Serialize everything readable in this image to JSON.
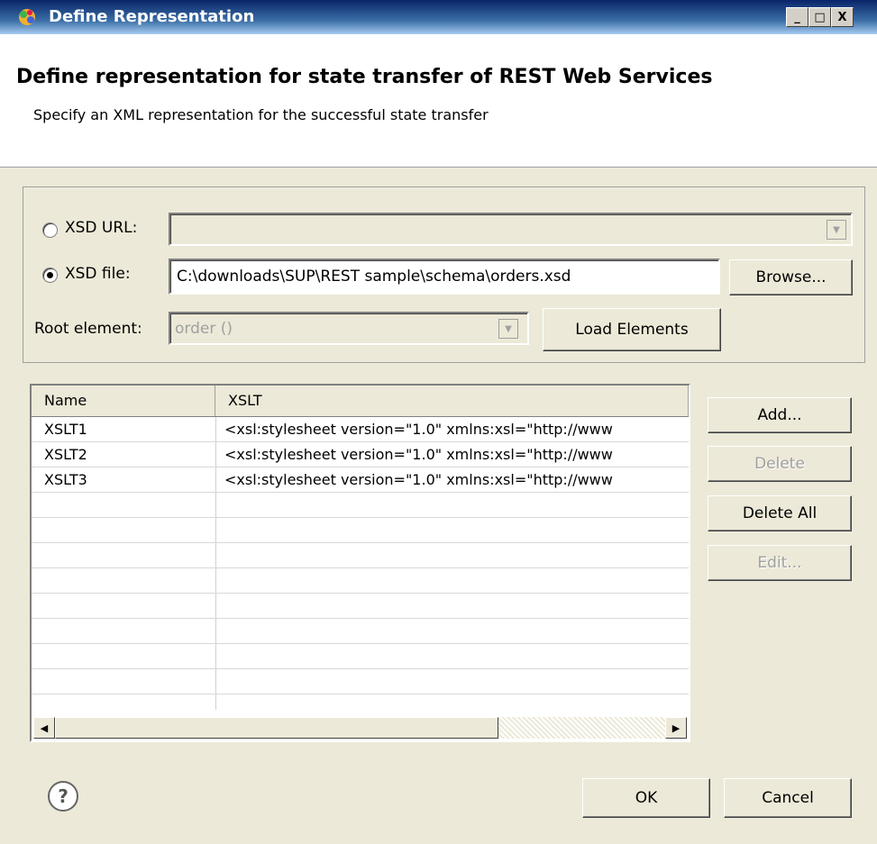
{
  "window": {
    "title": "Define Representation",
    "app_icon": "colorful-globe-icon",
    "minimize_glyph": "_",
    "maximize_glyph": "□",
    "close_glyph": "X"
  },
  "header": {
    "title": "Define representation for state transfer of REST Web Services",
    "description": "Specify an XML representation for the successful state transfer"
  },
  "form": {
    "xsd_url": {
      "label": "XSD URL:",
      "value": "",
      "selected": false
    },
    "xsd_file": {
      "label": "XSD file:",
      "value": "C:\\downloads\\SUP\\REST sample\\schema\\orders.xsd",
      "selected": true
    },
    "browse_label": "Browse...",
    "root_element": {
      "label": "Root element:",
      "value": "order ()"
    },
    "load_elements_label": "Load Elements"
  },
  "table": {
    "columns": [
      "Name",
      "XSLT"
    ],
    "rows": [
      {
        "name": "XSLT1",
        "xslt": "<xsl:stylesheet version=\"1.0\" xmlns:xsl=\"http://www"
      },
      {
        "name": "XSLT2",
        "xslt": "<xsl:stylesheet version=\"1.0\" xmlns:xsl=\"http://www"
      },
      {
        "name": "XSLT3",
        "xslt": "<xsl:stylesheet version=\"1.0\" xmlns:xsl=\"http://www"
      }
    ]
  },
  "side_buttons": {
    "add": "Add...",
    "delete": "Delete",
    "delete_all": "Delete All",
    "edit": "Edit..."
  },
  "footer": {
    "help_glyph": "?",
    "ok": "OK",
    "cancel": "Cancel"
  }
}
